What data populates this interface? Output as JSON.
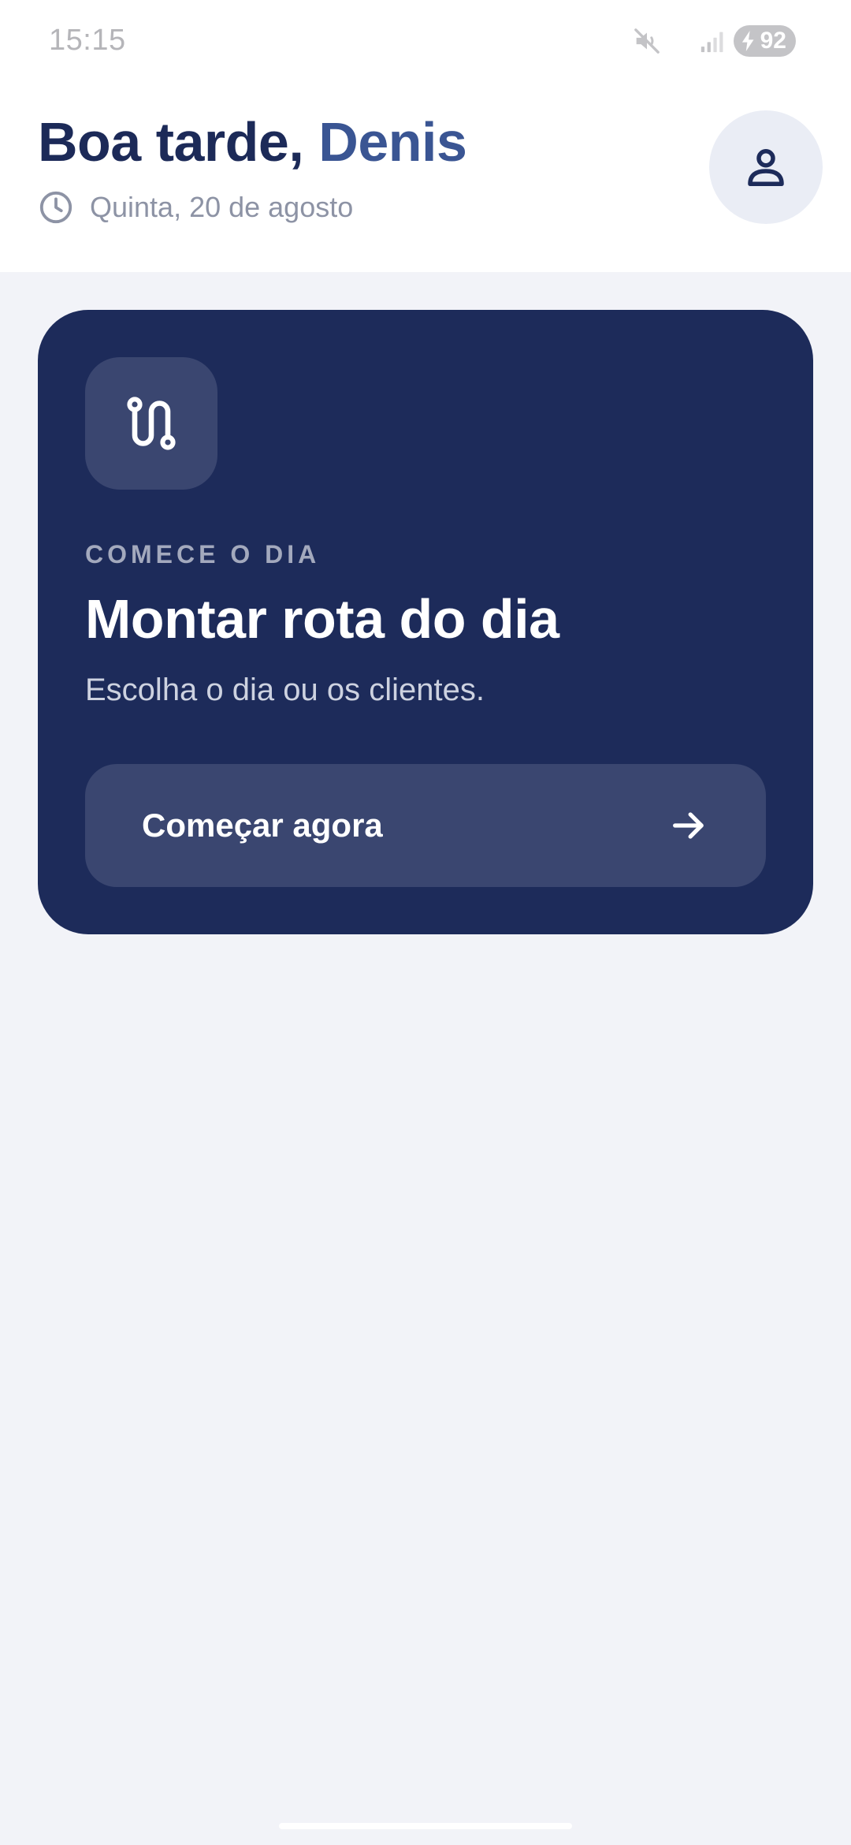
{
  "status_bar": {
    "time": "15:15",
    "battery_level": "92",
    "icons": [
      "mute-icon",
      "signal-icon",
      "battery-charging-icon"
    ]
  },
  "header": {
    "greeting_prefix": "Boa tarde, ",
    "user_name": "Denis",
    "date": "Quinta, 20 de agosto",
    "avatar_icon": "user-icon"
  },
  "card": {
    "icon": "route-icon",
    "eyebrow": "COMECE O DIA",
    "title": "Montar rota do dia",
    "subtitle": "Escolha o dia ou os clientes.",
    "button_label": "Começar agora",
    "button_icon": "arrow-right-icon"
  },
  "colors": {
    "background": "#f2f3f8",
    "primary_dark": "#1d2b5a",
    "accent_name": "#3a5593",
    "tile": "#3a4670",
    "muted_text": "#8d93a5"
  }
}
